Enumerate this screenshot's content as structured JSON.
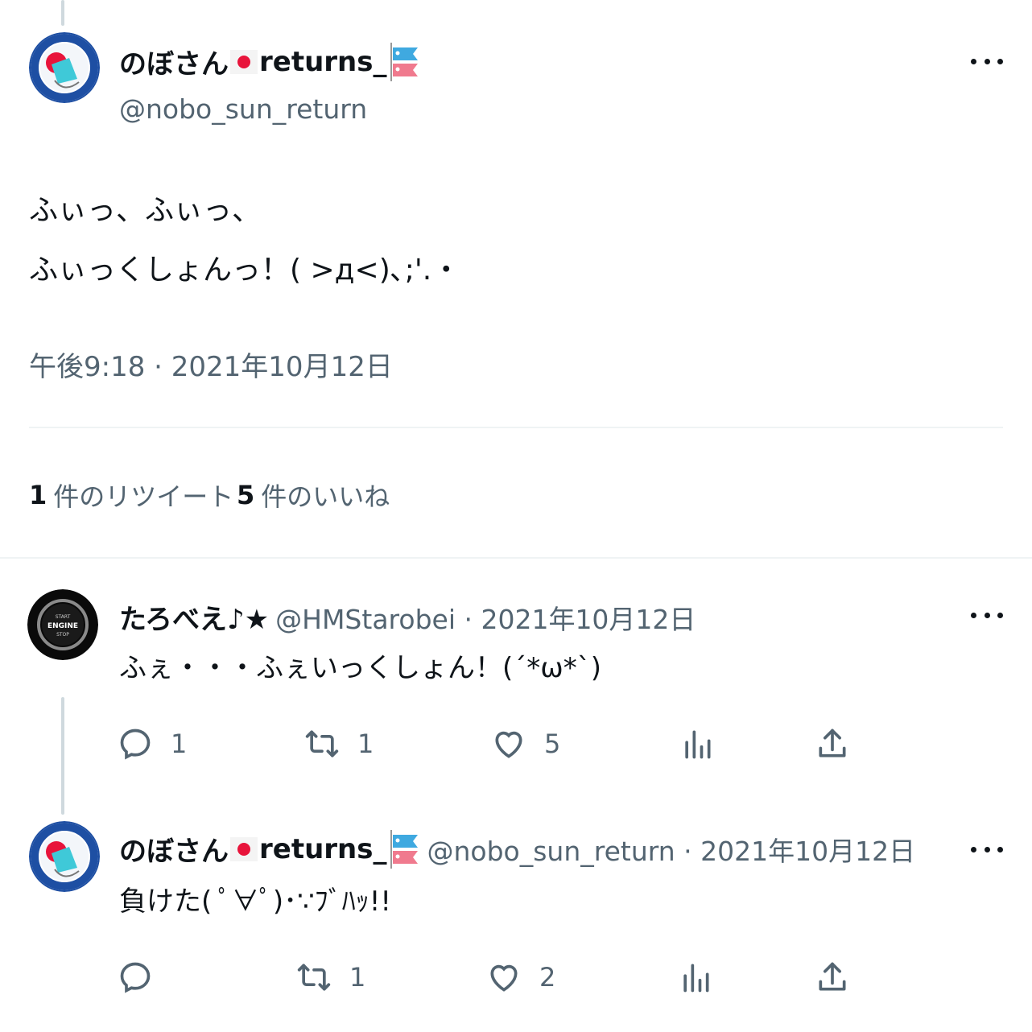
{
  "main_tweet": {
    "display_name": "のぼさん",
    "display_suffix": "returns_",
    "handle": "@nobo_sun_return",
    "text_line1": "ふぃっ、ふぃっ、",
    "text_line2": "ふぃっくしょんっ！( >д<)､;'.・",
    "timestamp": "午後9:18 · 2021年10月12日",
    "retweets_count": "1",
    "retweets_label": "件のリツイート",
    "likes_count": "5",
    "likes_label": "件のいいね"
  },
  "replies": [
    {
      "display_name": "たろべえ♪★",
      "handle": "@HMStarobei · 2021年10月12日",
      "text": "ふぇ・・・ふぇいっくしょん！(´*ω*`)",
      "reply_count": "1",
      "retweet_count": "1",
      "like_count": "5",
      "avatar_text_top": "START",
      "avatar_text_main": "ENGINE",
      "avatar_text_bottom": "STOP"
    },
    {
      "display_name": "のぼさん",
      "display_suffix": "returns_",
      "handle": "@nobo_sun_return · 2021年10月12日",
      "text": "負けた( ﾟ∀ﾟ)･∵ﾌﾞﾊｯ!!",
      "reply_count": "",
      "retweet_count": "1",
      "like_count": "2"
    }
  ],
  "colors": {
    "text": "#0f1419",
    "muted": "#536471",
    "divider": "#eff3f4",
    "thread_line": "#cfd9de"
  },
  "icons": [
    "more-icon",
    "reply-icon",
    "retweet-icon",
    "like-icon",
    "analytics-icon",
    "share-icon"
  ]
}
